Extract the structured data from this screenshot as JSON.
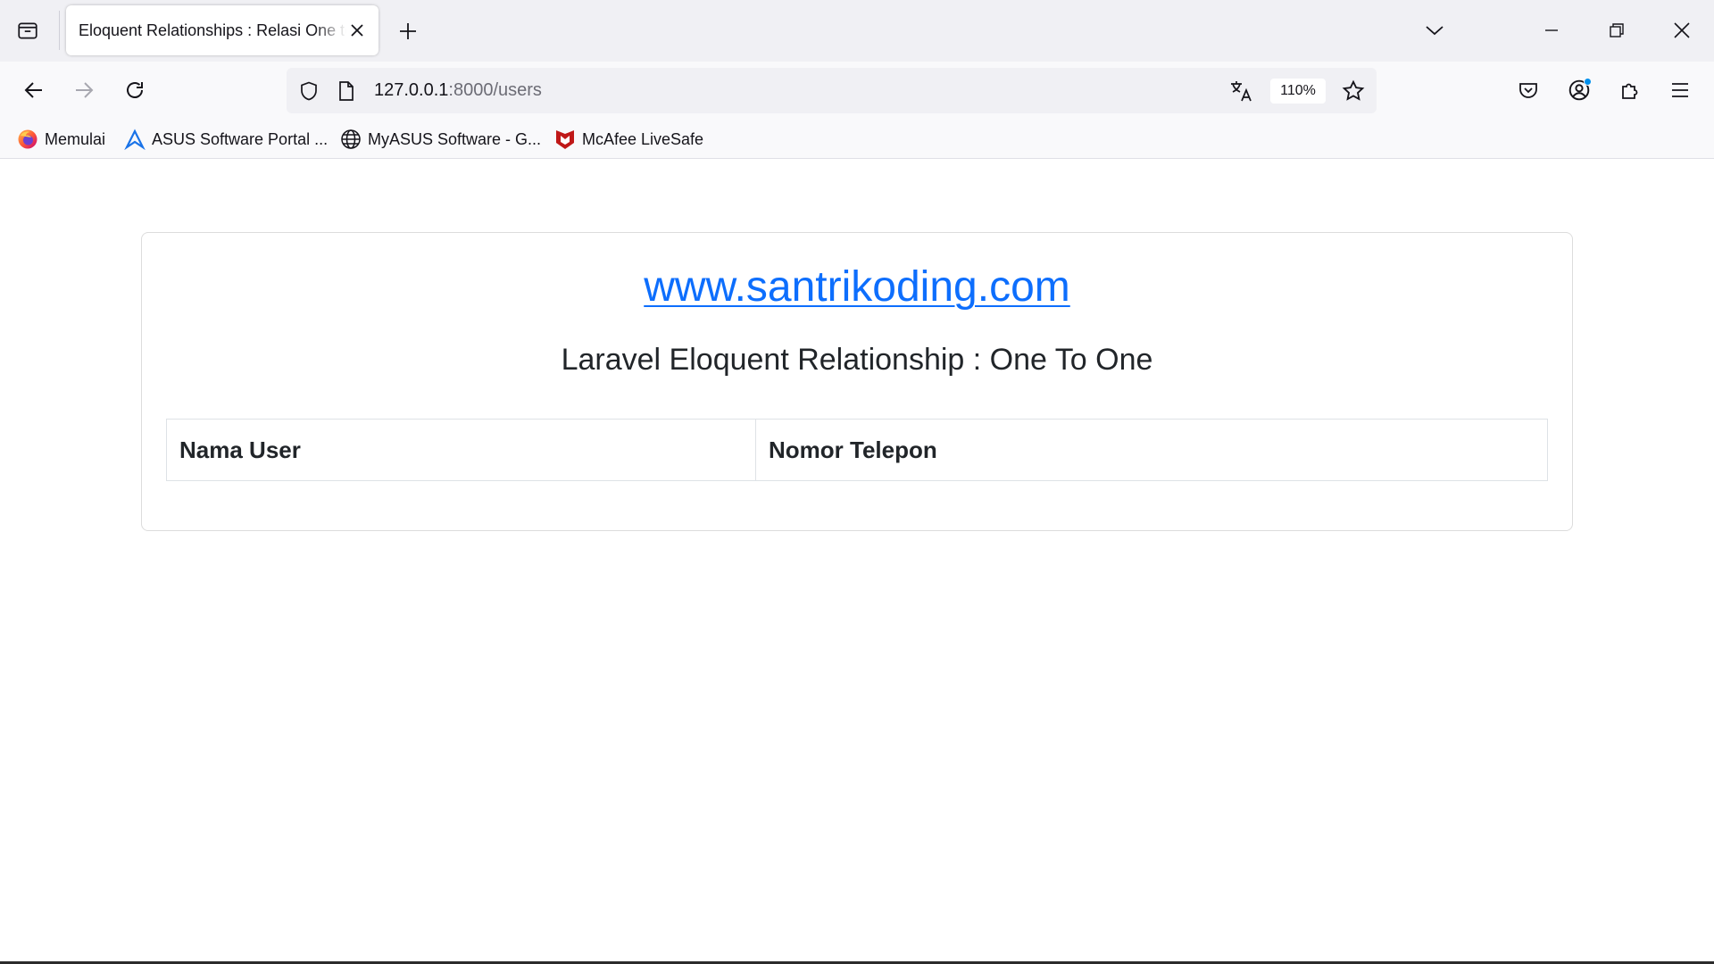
{
  "browser": {
    "tab": {
      "title": "Eloquent Relationships : Relasi One to One"
    },
    "address": {
      "host": "127.0.0.1",
      "path": ":8000/users"
    },
    "zoom_label": "110%",
    "bookmarks": [
      {
        "label": "Memulai",
        "icon": "firefox-icon"
      },
      {
        "label": "ASUS Software Portal ...",
        "icon": "asus-icon"
      },
      {
        "label": "MyASUS Software - G...",
        "icon": "globe-icon"
      },
      {
        "label": "McAfee LiveSafe",
        "icon": "mcafee-icon"
      }
    ],
    "colors": {
      "accent": "#0090ed",
      "tabstrip": "#f0f0f4",
      "toolbar": "#f9f9fb"
    }
  },
  "page": {
    "link_text": "www.santrikoding.com",
    "subtitle": "Laravel Eloquent Relationship : One To One",
    "table": {
      "headers": [
        "Nama User",
        "Nomor Telepon"
      ],
      "rows": []
    },
    "colors": {
      "link": "#0d6efd",
      "text": "#212529",
      "border": "#dee2e6"
    }
  }
}
